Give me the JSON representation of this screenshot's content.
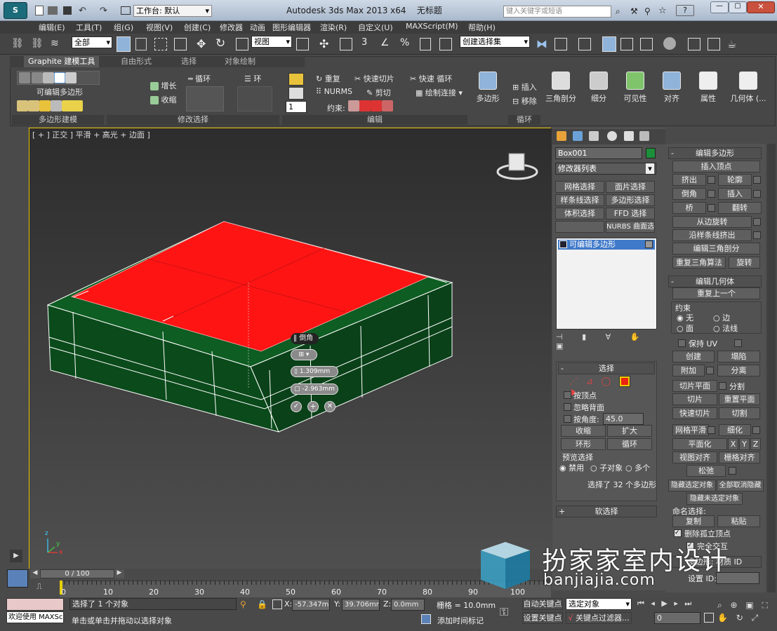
{
  "title_bar": {
    "workspace_label": "工作台: 默认",
    "app_title": "Autodesk 3ds Max  2013 x64",
    "file_name": "无标题",
    "search_placeholder": "键入关键字或短语",
    "help_label": "?"
  },
  "menu": [
    "编辑(E)",
    "工具(T)",
    "组(G)",
    "视图(V)",
    "创建(C)",
    "修改器",
    "动画",
    "图形编辑器",
    "渲染(R)",
    "自定义(U)",
    "MAXScript(M)",
    "帮助(H)"
  ],
  "toolbar": {
    "selection_filter": "全部",
    "ref_coord": "视图",
    "named_selection": "创建选择集",
    "snap_angle": "3",
    "percent_snap": "%"
  },
  "ribbon": {
    "tabs": [
      "Graphite 建模工具",
      "自由形式",
      "选择",
      "对象绘制"
    ],
    "active_tab": "Graphite 建模工具",
    "poly_modeling_label": "可编辑多边形",
    "groups": [
      "多边形建模",
      "修改选择",
      "编辑",
      "循环"
    ],
    "grow": "增长",
    "shrink": "收缩",
    "loop": "循环",
    "ring": "环",
    "repeat": "重复",
    "nurms": "NURMS",
    "quick_slice": "快速切片",
    "cut": "剪切",
    "quick_loop": "快速 循环",
    "paint_connect": "绘制连接",
    "constraint": "约束:",
    "spinner_value": "1",
    "insert": "插入",
    "remove": "移除",
    "big_buttons": [
      "多边形",
      "三角剖分",
      "细分",
      "可见性",
      "对齐",
      "属性",
      "几何体 (..."
    ]
  },
  "viewport": {
    "label": "[ + ] 正交 ] 平滑 + 高光 + 边面 ]",
    "caddy_title": "倒角",
    "height_value": "1.309mm",
    "outline_value": "-2.963mm",
    "axis_x": "x",
    "axis_y": "y",
    "axis_z": "z"
  },
  "command_panel": {
    "object_name": "Box001",
    "modifier_list": "修改器列表",
    "buttons": [
      "网格选择",
      "面片选择",
      "样条线选择",
      "多边形选择",
      "体积选择",
      "FFD 选择",
      "NURBS 曲面选择"
    ],
    "stack_item": "可编辑多边形",
    "selection_header": "选择",
    "by_vertex": "按顶点",
    "ignore_backfacing": "忽略背面",
    "by_angle": "按角度:",
    "angle_value": "45.0",
    "shrink": "收缩",
    "grow": "扩大",
    "ring": "环形",
    "loop": "循环",
    "preview_selection": "预览选择",
    "disabled": "禁用",
    "subobject": "子对象",
    "multi": "多个",
    "selected_count": "选择了 32 个多边形",
    "soft_selection": "软选择"
  },
  "edit_polygons": {
    "header": "编辑多边形",
    "insert_vertex": "插入顶点",
    "extrude": "挤出",
    "outline": "轮廓",
    "bevel": "倒角",
    "inset": "插入",
    "bridge": "桥",
    "flip": "翻转",
    "hinge_from_edge": "从边旋转",
    "extrude_along_spline": "沿样条线挤出",
    "edit_triangulation": "编辑三角剖分",
    "retriangulate": "重复三角算法",
    "turn": "旋转"
  },
  "edit_geometry": {
    "header": "编辑几何体",
    "repeat_last": "重复上一个",
    "constraints": "约束",
    "none": "无",
    "edge": "边",
    "face": "面",
    "normal": "法线",
    "preserve_uv": "保持 UV",
    "create": "创建",
    "collapse": "塌陷",
    "attach": "附加",
    "detach": "分离",
    "slice_plane": "切片平面",
    "split": "分割",
    "slice": "切片",
    "reset_plane": "重置平面",
    "quickslice": "快速切片",
    "cut": "切割",
    "meshsmooth": "网格平滑",
    "tessellate": "细化",
    "make_planar": "平面化",
    "x": "X",
    "y": "Y",
    "z": "Z",
    "view_align": "视图对齐",
    "grid_align": "栅格对齐",
    "relax": "松弛",
    "hide_selected": "隐藏选定对象",
    "unhide_all": "全部取消隐藏",
    "hide_unselected": "隐藏未选定对象",
    "named_selections": "命名选择:",
    "copy": "复制",
    "paste": "粘贴",
    "delete_isolated": "删除孤立顶点",
    "full_interactivity": "完全交互",
    "poly_material_ids": "多边形: 材质 ID",
    "set_id": "设置 ID:"
  },
  "timeline": {
    "frame_label": "0 / 100",
    "ticks": [
      "0",
      "10",
      "20",
      "30",
      "40",
      "50",
      "60",
      "70",
      "80",
      "90",
      "100"
    ]
  },
  "status_bar": {
    "welcome": "欢迎使用  MAXSc",
    "selected": "选择了 1 个对象",
    "prompt": "单击或单击并拖动以选择对象",
    "x_label": "X:",
    "x_value": "-57.347mm",
    "y_label": "Y:",
    "y_value": "39.706mm",
    "z_label": "Z:",
    "z_value": "0.0mm",
    "grid": "栅格 = 10.0mm",
    "add_time_tag": "添加时间标记",
    "auto_key": "自动关键点",
    "set_key": "设置关键点",
    "selected_object": "选定对象",
    "key_filters": "关键点过滤器...",
    "frame_spinner": "0"
  },
  "watermark": {
    "name": "扮家家室内设计",
    "url": "banjiajia.com"
  },
  "colors": {
    "viewport_bg": "#3b3b3b",
    "selection_red": "#ff1414",
    "mesh_green": "#0b5a1f",
    "active_border": "#e6c400"
  }
}
